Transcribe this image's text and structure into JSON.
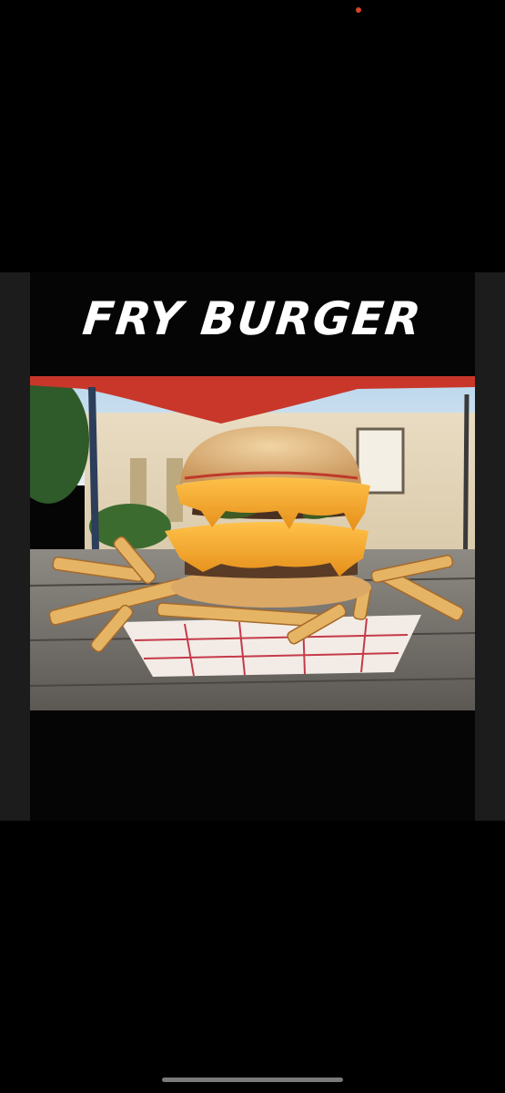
{
  "post": {
    "title": "FRY BURGER",
    "photo_icon": "burger-and-fries-photo"
  },
  "colors": {
    "background": "#000000",
    "canopy": "#c8372a",
    "cheese": "#f2a529",
    "bun": "#d9a35f",
    "fries": "#e8b96b",
    "tray_stripe": "#c53a4a"
  }
}
